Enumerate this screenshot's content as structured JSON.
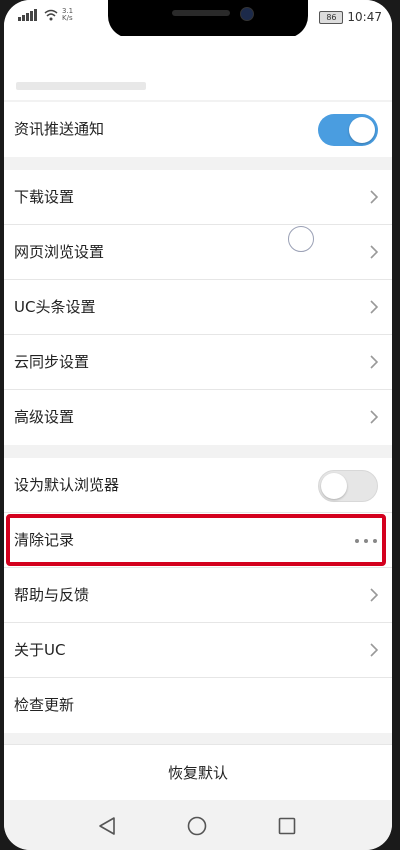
{
  "status_bar": {
    "net_speed": "3.1 K/s",
    "battery": "86",
    "time": "10:47"
  },
  "section_top": {
    "news_push": {
      "label": "资讯推送通知",
      "toggle": "on"
    }
  },
  "section_settings": {
    "items": [
      {
        "label": "下载设置"
      },
      {
        "label": "网页浏览设置"
      },
      {
        "label": "UC头条设置"
      },
      {
        "label": "云同步设置"
      },
      {
        "label": "高级设置"
      }
    ]
  },
  "section_misc": {
    "default_browser": {
      "label": "设为默认浏览器",
      "toggle": "off"
    },
    "clear_records": {
      "label": "清除记录"
    },
    "help_feedback": {
      "label": "帮助与反馈"
    },
    "about": {
      "label": "关于UC"
    },
    "check_update": {
      "label": "检查更新"
    }
  },
  "restore": {
    "label": "恢复默认"
  },
  "colors": {
    "accent": "#4a9de0",
    "highlight": "#d4001e"
  }
}
